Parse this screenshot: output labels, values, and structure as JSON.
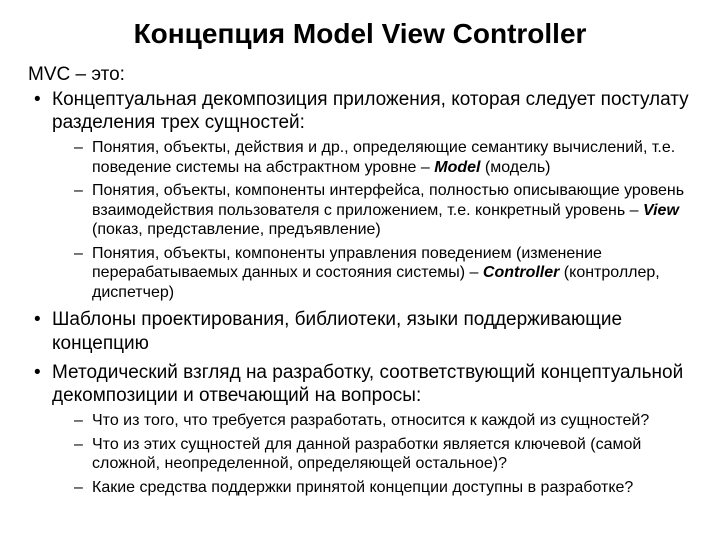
{
  "title": "Концепция Model View Controller",
  "intro": "MVC – это:",
  "bullets": [
    {
      "text": "Концептуальная декомпозиция приложения, которая следует постулату разделения трех сущностей:",
      "sub": [
        {
          "pre": "Понятия, объекты, действия и др., определяющие семантику вычислений, т.е. поведение системы на абстрактном уровне – ",
          "em": "Model",
          "post": " (модель)"
        },
        {
          "pre": "Понятия, объекты, компоненты интерфейса, полностью описывающие уровень взаимодействия пользователя с приложением, т.е. конкретный уровень – ",
          "em": "View",
          "post": " (показ, представление, предъявление)"
        },
        {
          "pre": "Понятия, объекты, компоненты управления поведением (изменение перерабатываемых данных и состояния системы) – ",
          "em": "Controller",
          "post": " (контроллер, диспетчер)"
        }
      ]
    },
    {
      "text": "Шаблоны проектирования, библиотеки, языки поддерживающие концепцию",
      "sub": []
    },
    {
      "text": "Методический взгляд на разработку, соответствующий концептуальной декомпозиции и отвечающий на вопросы:",
      "sub": [
        {
          "pre": "Что из того, что требуется разработать, относится к каждой из сущностей?",
          "em": "",
          "post": ""
        },
        {
          "pre": "Что из этих сущностей для данной разработки является ключевой (самой сложной, неопределенной, определяющей остальное)?",
          "em": "",
          "post": ""
        },
        {
          "pre": "Какие средства поддержки принятой концепции доступны в разработке?",
          "em": "",
          "post": ""
        }
      ]
    }
  ]
}
